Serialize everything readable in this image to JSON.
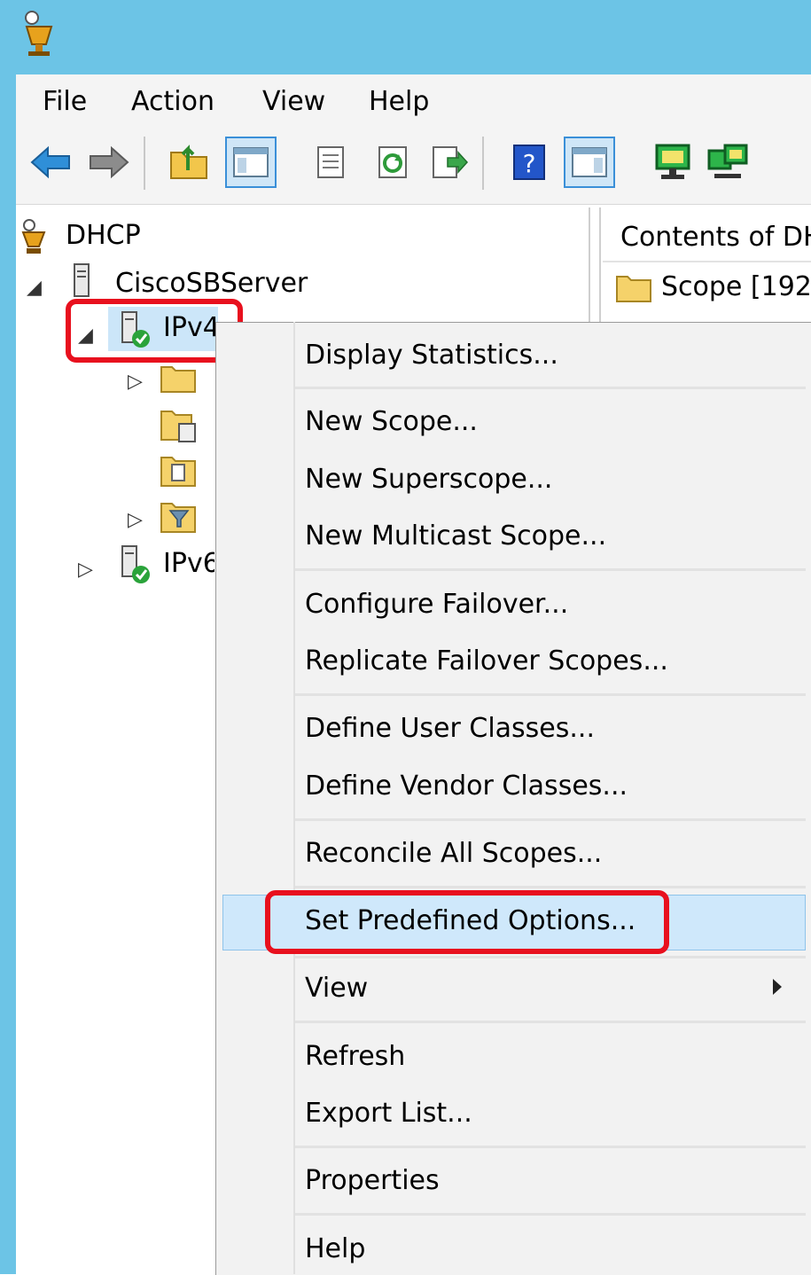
{
  "menubar": {
    "file": "File",
    "action": "Action",
    "view": "View",
    "help": "Help"
  },
  "tree": {
    "root": "DHCP",
    "server": "CiscoSBServer",
    "ipv4": "IPv4",
    "ipv6": "IPv6"
  },
  "content": {
    "header": "Contents of DHCP",
    "row1": "Scope [192"
  },
  "context_menu": {
    "display_statistics": "Display Statistics...",
    "new_scope": "New Scope...",
    "new_superscope": "New Superscope...",
    "new_multicast_scope": "New Multicast Scope...",
    "configure_failover": "Configure Failover...",
    "replicate_failover_scopes": "Replicate Failover Scopes...",
    "define_user_classes": "Define User Classes...",
    "define_vendor_classes": "Define Vendor Classes...",
    "reconcile_all_scopes": "Reconcile All Scopes...",
    "set_predefined_options": "Set Predefined Options...",
    "view": "View",
    "refresh": "Refresh",
    "export_list": "Export List...",
    "properties": "Properties",
    "help": "Help"
  },
  "colors": {
    "titlebar": "#6cc4e6",
    "highlight_red": "#e8101e",
    "menu_hover": "#cfe8fb"
  }
}
